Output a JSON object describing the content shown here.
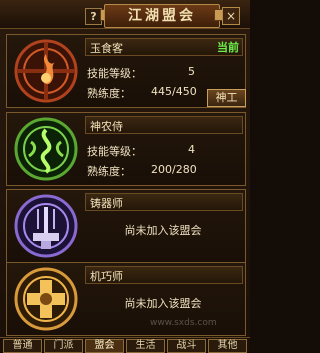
{
  "window": {
    "title": "江湖盟会",
    "help_label": "?",
    "close_label": "×"
  },
  "guilds": [
    {
      "name": "玉食客",
      "status": "当前",
      "level_label": "技能等级：",
      "level_value": "5",
      "proficiency_label": "熟练度：",
      "proficiency_value": "445/450",
      "rank_button": "神工",
      "icon": "flame-medallion-icon"
    },
    {
      "name": "神农侍",
      "level_label": "技能等级：",
      "level_value": "4",
      "proficiency_label": "熟练度：",
      "proficiency_value": "200/280",
      "icon": "herb-swirl-icon"
    },
    {
      "name": "铸器师",
      "message": "尚未加入该盟会",
      "icon": "anvil-hammer-icon"
    },
    {
      "name": "机巧师",
      "message": "尚未加入该盟会",
      "icon": "gear-cross-icon"
    }
  ],
  "tabs": [
    "普通",
    "门派",
    "盟会",
    "生活",
    "战斗",
    "其他"
  ],
  "watermark": "www.sxds.com",
  "colors": {
    "accent": "#c89a52",
    "current_status": "#6cf04a",
    "text": "#f0e2c0"
  }
}
